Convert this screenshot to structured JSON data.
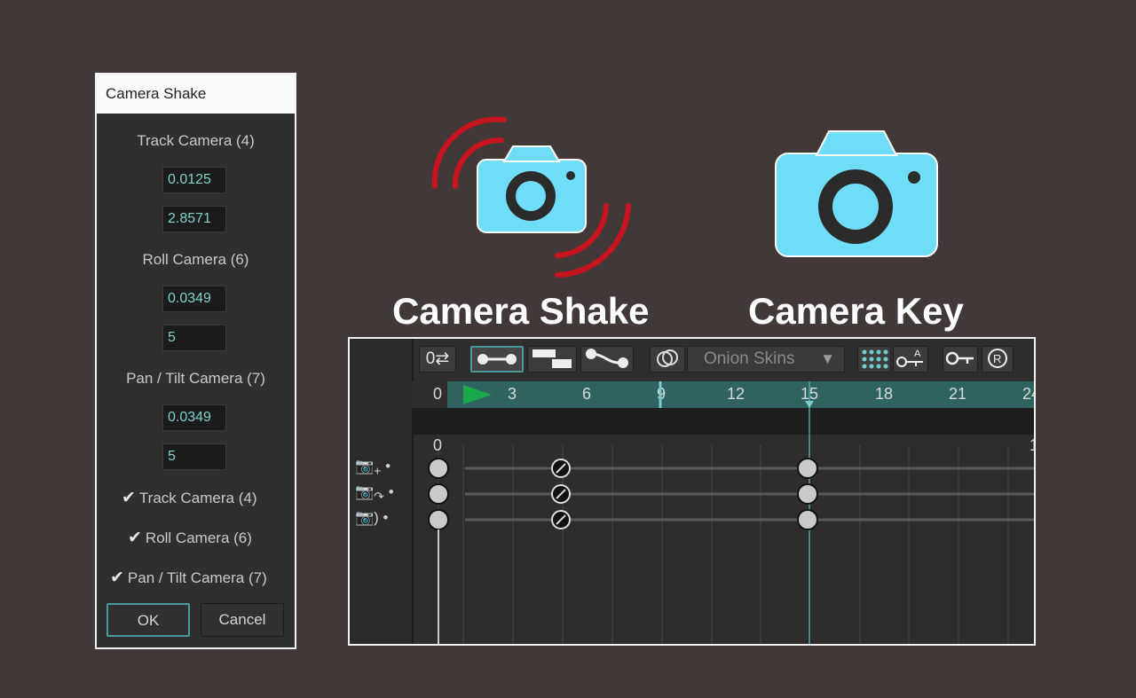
{
  "dialog": {
    "title": "Camera Shake",
    "sections": [
      {
        "label": "Track Camera (4)",
        "values": [
          "0.0125",
          "2.8571"
        ]
      },
      {
        "label": "Roll Camera (6)",
        "values": [
          "0.0349",
          "5"
        ]
      },
      {
        "label": "Pan / Tilt Camera (7)",
        "values": [
          "0.0349",
          "5"
        ]
      }
    ],
    "checkboxes": [
      {
        "label": "Track Camera (4)",
        "checked": true
      },
      {
        "label": "Roll Camera (6)",
        "checked": true
      },
      {
        "label": "Pan / Tilt Camera (7)",
        "checked": true
      }
    ],
    "ok_label": "OK",
    "cancel_label": "Cancel"
  },
  "headings": {
    "camera_shake": "Camera Shake",
    "camera_key": "Camera Key"
  },
  "icons": {
    "camera_color": "#6fdcf8",
    "shake_color": "#c8141e"
  },
  "timeline": {
    "loop_label": "0⇄",
    "onion_label": "Onion Skins",
    "ruler_labels": [
      "0",
      "3",
      "6",
      "9",
      "12",
      "15",
      "18",
      "21",
      "24"
    ],
    "grid_top_label": "0",
    "grid_top_right_label": "1",
    "accent": "#2f6360",
    "playhead_frame": 15
  }
}
